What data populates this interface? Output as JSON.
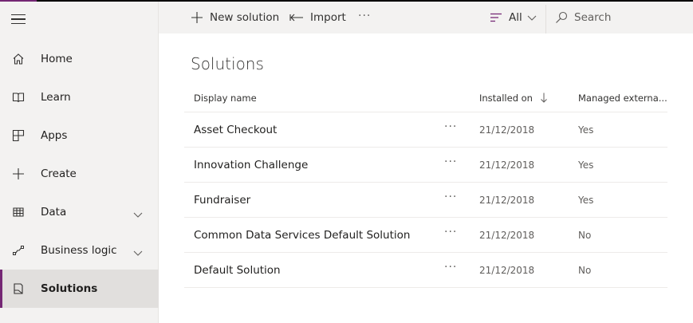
{
  "sidebar": {
    "items": [
      {
        "label": "Home",
        "icon": "home-icon"
      },
      {
        "label": "Learn",
        "icon": "book-icon"
      },
      {
        "label": "Apps",
        "icon": "apps-icon"
      },
      {
        "label": "Create",
        "icon": "plus-icon"
      },
      {
        "label": "Data",
        "icon": "table-icon",
        "expandable": true
      },
      {
        "label": "Business logic",
        "icon": "flow-icon",
        "expandable": true
      },
      {
        "label": "Solutions",
        "icon": "solutions-icon",
        "active": true
      }
    ]
  },
  "commandbar": {
    "new_label": "New solution",
    "import_label": "Import",
    "more": "···",
    "filter_label": "All",
    "search_placeholder": "Search"
  },
  "main": {
    "title": "Solutions",
    "columns": {
      "name": "Display name",
      "installed": "Installed on",
      "managed": "Managed externa..."
    },
    "row_more": "···",
    "rows": [
      {
        "name": "Asset Checkout",
        "installed": "21/12/2018",
        "managed": "Yes"
      },
      {
        "name": "Innovation Challenge",
        "installed": "21/12/2018",
        "managed": "Yes"
      },
      {
        "name": "Fundraiser",
        "installed": "21/12/2018",
        "managed": "Yes"
      },
      {
        "name": "Common Data Services Default Solution",
        "installed": "21/12/2018",
        "managed": "No"
      },
      {
        "name": "Default Solution",
        "installed": "21/12/2018",
        "managed": "No"
      }
    ]
  },
  "colors": {
    "accent": "#742774",
    "sidebar_bg": "#f3f2f1",
    "active_bg": "#e1dfdd"
  }
}
